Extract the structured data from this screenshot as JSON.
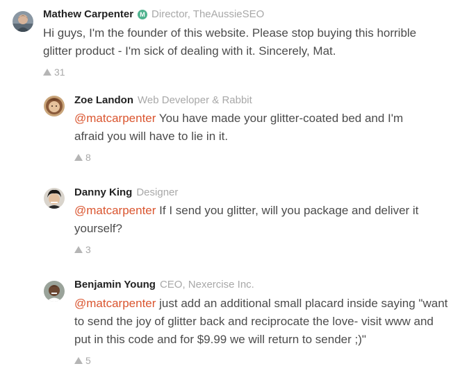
{
  "comments": [
    {
      "author": "Mathew Carpenter",
      "badge": "M",
      "headline": "Director, TheAussieSEO",
      "body": "Hi guys, I'm the founder of this website. Please stop buying this horrible glitter product - I'm sick of dealing with it. Sincerely, Mat.",
      "votes": "31"
    },
    {
      "author": "Zoe Landon",
      "headline": "Web Developer & Rabbit",
      "mention": "@matcarpenter",
      "body": " You have made your glitter-coated bed and I'm afraid you will have to lie in it.",
      "votes": "8"
    },
    {
      "author": "Danny King",
      "headline": "Designer",
      "mention": "@matcarpenter",
      "body": " If I send you glitter, will you package and deliver it yourself?",
      "votes": "3"
    },
    {
      "author": "Benjamin Young",
      "headline": "CEO, Nexercise Inc.",
      "mention": "@matcarpenter",
      "body": " just add an additional small placard inside saying \"want to send the joy of glitter back and reciprocate the love- visit www and put in this code and for $9.99 we will return to sender ;)\"",
      "votes": "5"
    }
  ],
  "colors": {
    "mention": "#da552f",
    "maker_badge": "#4fb38f",
    "muted": "#a8a8a8",
    "name": "#222222",
    "body": "#4b4b4b"
  }
}
